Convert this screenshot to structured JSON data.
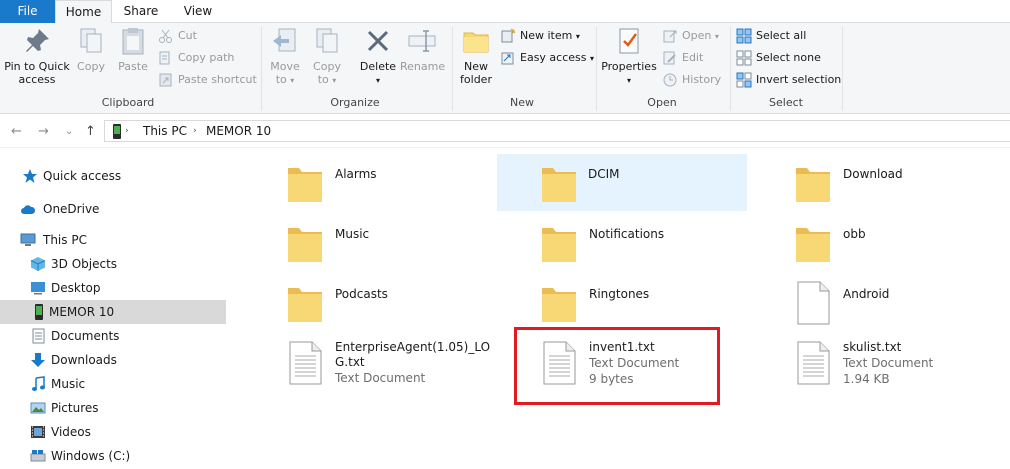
{
  "tabs": {
    "file": "File",
    "home": "Home",
    "share": "Share",
    "view": "View"
  },
  "ribbon": {
    "clipboard": {
      "label": "Clipboard",
      "pin_line1": "Pin to Quick",
      "pin_line2": "access",
      "copy": "Copy",
      "paste": "Paste",
      "cut": "Cut",
      "copy_path": "Copy path",
      "paste_shortcut": "Paste shortcut"
    },
    "organize": {
      "label": "Organize",
      "move_to_line1": "Move",
      "move_to_line2": "to",
      "copy_to_line1": "Copy",
      "copy_to_line2": "to",
      "delete": "Delete",
      "rename": "Rename"
    },
    "new": {
      "label": "New",
      "new_folder_line1": "New",
      "new_folder_line2": "folder",
      "new_item": "New item",
      "easy_access": "Easy access"
    },
    "open": {
      "label": "Open",
      "properties": "Properties",
      "open": "Open",
      "edit": "Edit",
      "history": "History"
    },
    "select": {
      "label": "Select",
      "select_all": "Select all",
      "select_none": "Select none",
      "invert_selection": "Invert selection"
    }
  },
  "address": {
    "crumbs": [
      "This PC",
      "MEMOR 10"
    ]
  },
  "nav": {
    "items": [
      {
        "label": "Quick access"
      },
      {
        "label": "OneDrive"
      },
      {
        "label": "This PC"
      },
      {
        "label": "3D Objects"
      },
      {
        "label": "Desktop"
      },
      {
        "label": "MEMOR 10"
      },
      {
        "label": "Documents"
      },
      {
        "label": "Downloads"
      },
      {
        "label": "Music"
      },
      {
        "label": "Pictures"
      },
      {
        "label": "Videos"
      },
      {
        "label": "Windows (C:)"
      }
    ]
  },
  "files": [
    {
      "name": "Alarms"
    },
    {
      "name": "DCIM"
    },
    {
      "name": "Download"
    },
    {
      "name": "Music"
    },
    {
      "name": "Notifications"
    },
    {
      "name": "obb"
    },
    {
      "name": "Podcasts"
    },
    {
      "name": "Ringtones"
    },
    {
      "name": "Android"
    },
    {
      "name": "EnterpriseAgent(1.05)_LOG.txt",
      "type": "Text Document"
    },
    {
      "name": "invent1.txt",
      "type": "Text Document",
      "size": "9 bytes"
    },
    {
      "name": "skulist.txt",
      "type": "Text Document",
      "size": "1.94 KB"
    }
  ],
  "colors": {
    "accent": "#1979ca",
    "folder": "#f8d775",
    "highlight": "#e21a22",
    "hover": "#e5f3ff"
  }
}
